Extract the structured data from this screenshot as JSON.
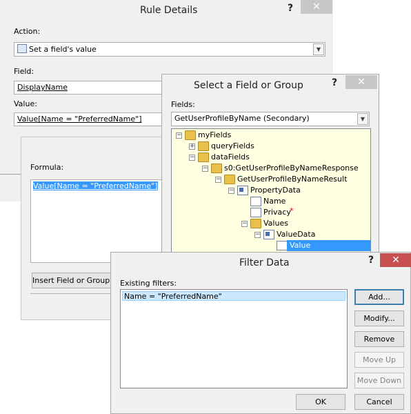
{
  "rule_details": {
    "title": "Rule Details",
    "help": "?",
    "close": "✕",
    "action_label": "Action:",
    "action_value": "Set a field's value",
    "field_label": "Field:",
    "field_value": "DisplayName",
    "value_label": "Value:",
    "value_value": "Value[Name = \"PreferredName\"]",
    "formula_label": "Formula:",
    "formula_value": "Value[Name = \"PreferredName\"]",
    "insert_button": "Insert Field or Group..."
  },
  "select_field": {
    "title": "Select a Field or Group",
    "help": "?",
    "close": "✕",
    "fields_label": "Fields:",
    "source_value": "GetUserProfileByName (Secondary)",
    "tree": [
      {
        "label": "myFields",
        "depth": 0,
        "expander": "minus",
        "icon": "folder"
      },
      {
        "label": "queryFields",
        "depth": 1,
        "expander": "plus",
        "icon": "folder"
      },
      {
        "label": "dataFields",
        "depth": 1,
        "expander": "minus",
        "icon": "folder"
      },
      {
        "label": "s0:GetUserProfileByNameResponse",
        "depth": 2,
        "expander": "minus",
        "icon": "folder"
      },
      {
        "label": "GetUserProfileByNameResult",
        "depth": 3,
        "expander": "minus",
        "icon": "folder"
      },
      {
        "label": "PropertyData",
        "depth": 4,
        "expander": "minus",
        "icon": "group"
      },
      {
        "label": "Name",
        "depth": 5,
        "expander": "none",
        "icon": "field"
      },
      {
        "label": "Privacy",
        "depth": 5,
        "expander": "none",
        "icon": "field",
        "required": "*"
      },
      {
        "label": "Values",
        "depth": 5,
        "expander": "minus",
        "icon": "folder"
      },
      {
        "label": "ValueData",
        "depth": 6,
        "expander": "minus",
        "icon": "group"
      },
      {
        "label": "Value",
        "depth": 7,
        "expander": "none",
        "icon": "field",
        "selected": true
      }
    ]
  },
  "filter_data": {
    "title": "Filter Data",
    "help": "?",
    "close": "✕",
    "existing_label": "Existing filters:",
    "filters": [
      "Name = \"PreferredName\""
    ],
    "add": "Add...",
    "modify": "Modify...",
    "remove": "Remove",
    "move_up": "Move Up",
    "move_down": "Move Down",
    "ok": "OK",
    "cancel": "Cancel"
  }
}
